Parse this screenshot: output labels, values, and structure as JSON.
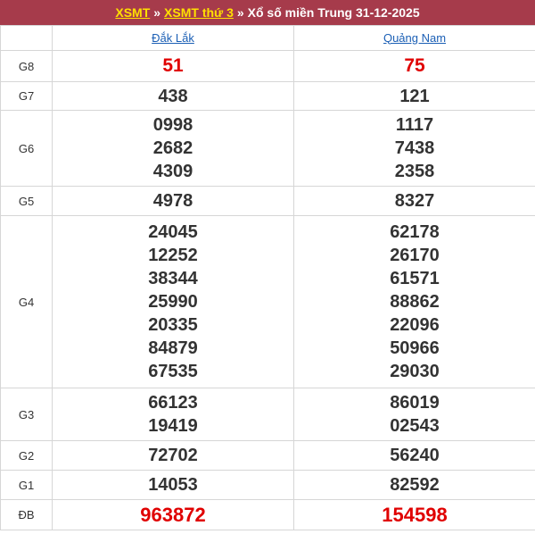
{
  "header": {
    "link1": "XSMT",
    "link2": "XSMT thứ 3",
    "separator": "»",
    "title": "Xổ số miền Trung 31-12-2025"
  },
  "provinces": [
    "Đắk Lắk",
    "Quảng Nam"
  ],
  "prizes": [
    {
      "label": "G8",
      "p1": [
        "51"
      ],
      "p2": [
        "75"
      ]
    },
    {
      "label": "G7",
      "p1": [
        "438"
      ],
      "p2": [
        "121"
      ]
    },
    {
      "label": "G6",
      "p1": [
        "0998",
        "2682",
        "4309"
      ],
      "p2": [
        "1117",
        "7438",
        "2358"
      ]
    },
    {
      "label": "G5",
      "p1": [
        "4978"
      ],
      "p2": [
        "8327"
      ]
    },
    {
      "label": "G4",
      "p1": [
        "24045",
        "12252",
        "38344",
        "25990",
        "20335",
        "84879",
        "67535"
      ],
      "p2": [
        "62178",
        "26170",
        "61571",
        "88862",
        "22096",
        "50966",
        "29030"
      ]
    },
    {
      "label": "G3",
      "p1": [
        "66123",
        "19419"
      ],
      "p2": [
        "86019",
        "02543"
      ]
    },
    {
      "label": "G2",
      "p1": [
        "72702"
      ],
      "p2": [
        "56240"
      ]
    },
    {
      "label": "G1",
      "p1": [
        "14053"
      ],
      "p2": [
        "82592"
      ]
    },
    {
      "label": "ĐB",
      "p1": [
        "963872"
      ],
      "p2": [
        "154598"
      ]
    }
  ],
  "colors": {
    "header_bg": "#a63b4b",
    "header_link": "#ffe000",
    "prize_red": "#e00000",
    "link_blue": "#1b5fb5"
  }
}
